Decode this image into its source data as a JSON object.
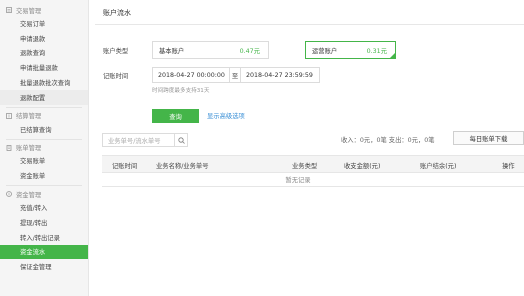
{
  "sidebar": {
    "sections": [
      {
        "title": "交易管理",
        "icon": "transactions-icon",
        "items": [
          {
            "label": "交易订单"
          },
          {
            "label": "申请退款"
          },
          {
            "label": "退款查询"
          },
          {
            "label": "申请批量退款"
          },
          {
            "label": "批量退款批次查询"
          },
          {
            "label": "退款配置"
          }
        ]
      },
      {
        "title": "结算管理",
        "icon": "settlement-icon",
        "items": [
          {
            "label": "已结算查询"
          }
        ]
      },
      {
        "title": "账单管理",
        "icon": "bill-icon",
        "items": [
          {
            "label": "交易账单"
          },
          {
            "label": "资金账单"
          }
        ]
      },
      {
        "title": "资金管理",
        "icon": "funds-icon",
        "items": [
          {
            "label": "充值/转入"
          },
          {
            "label": "提现/转出"
          },
          {
            "label": "转入/转出记录"
          },
          {
            "label": "资金流水"
          },
          {
            "label": "保证金管理"
          }
        ]
      }
    ],
    "active_item": "资金流水",
    "accent_color": "#44b549"
  },
  "main": {
    "title": "账户流水",
    "account_type_label": "账户类型",
    "accounts": [
      {
        "name": "基本账户",
        "amount": "0.47元",
        "selected": false
      },
      {
        "name": "运营账户",
        "amount": "0.31元",
        "selected": true
      }
    ],
    "time_label": "记账时间",
    "date_start": "2018-04-27 00:00:00",
    "date_separator": "至",
    "date_end": "2018-04-27 23:59:59",
    "time_hint": "时间跨度最多支持31天",
    "query_button": "查询",
    "advanced_link": "显示高级选项",
    "search_placeholder": "业务单号/流水单号",
    "summary": "收入：0元，0笔    支出：0元，0笔",
    "daily_bill_button": "每日账单下载",
    "table": {
      "columns": [
        "记账时间",
        "业务名称/业务单号",
        "业务类型",
        "收支金额(元)",
        "账户结余(元)",
        "操作"
      ],
      "empty_text": "暂无记录"
    }
  }
}
